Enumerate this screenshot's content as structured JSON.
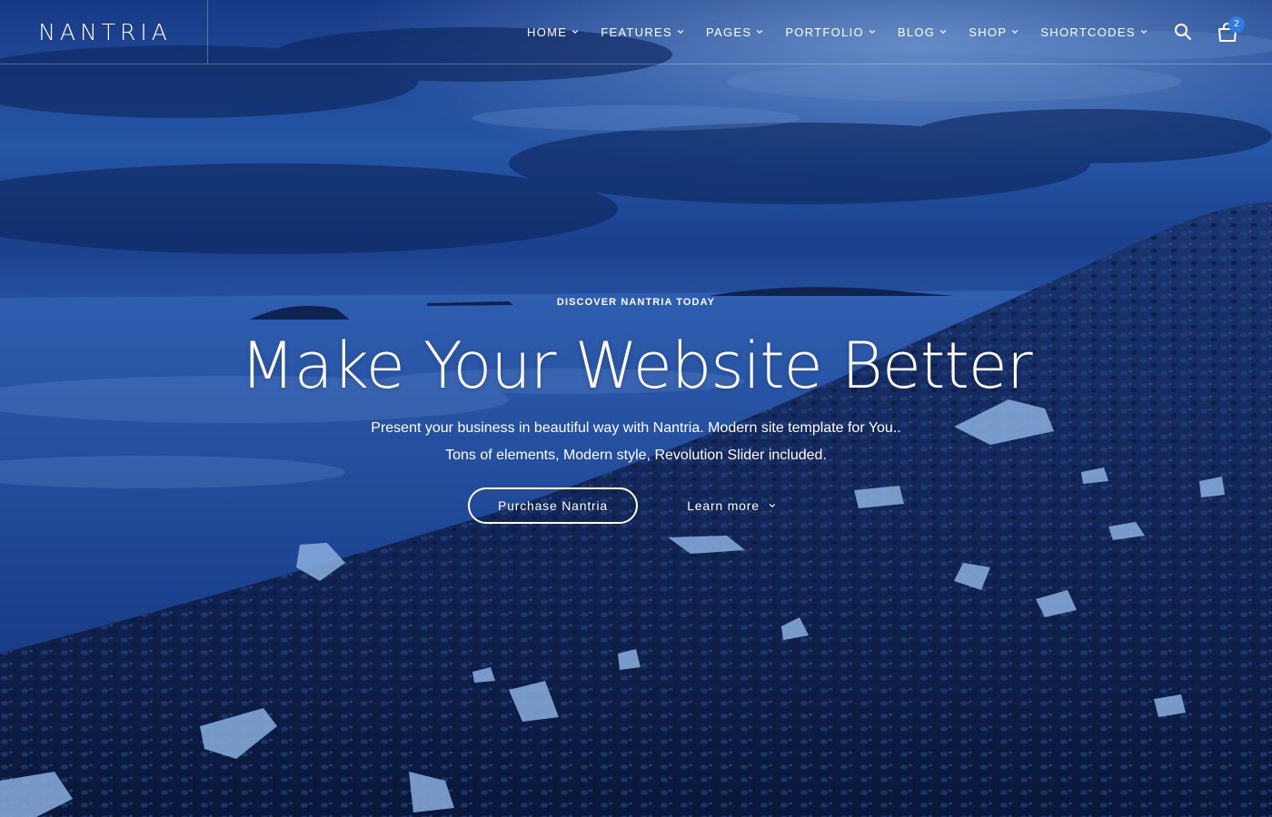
{
  "brand": {
    "logo_text": "NANTRIA"
  },
  "nav": {
    "items": [
      {
        "label": "HOME"
      },
      {
        "label": "FEATURES"
      },
      {
        "label": "PAGES"
      },
      {
        "label": "PORTFOLIO"
      },
      {
        "label": "BLOG"
      },
      {
        "label": "SHOP"
      },
      {
        "label": "SHORTCODES"
      }
    ],
    "search_icon": "search-icon",
    "cart_icon": "cart-icon",
    "cart_count": "2"
  },
  "hero": {
    "eyebrow": "DISCOVER NANTRIA TODAY",
    "headline": "Make Your Website Better",
    "subtitle_line1": "Present your business in beautiful way with Nantria. Modern site template for You..",
    "subtitle_line2": "Tons of elements, Modern style, Revolution Slider included.",
    "primary_button": "Purchase Nantria",
    "secondary_button": "Learn more"
  },
  "colors": {
    "badge": "#2f7de1",
    "overlay": "#0b2150",
    "text": "#ffffff"
  }
}
